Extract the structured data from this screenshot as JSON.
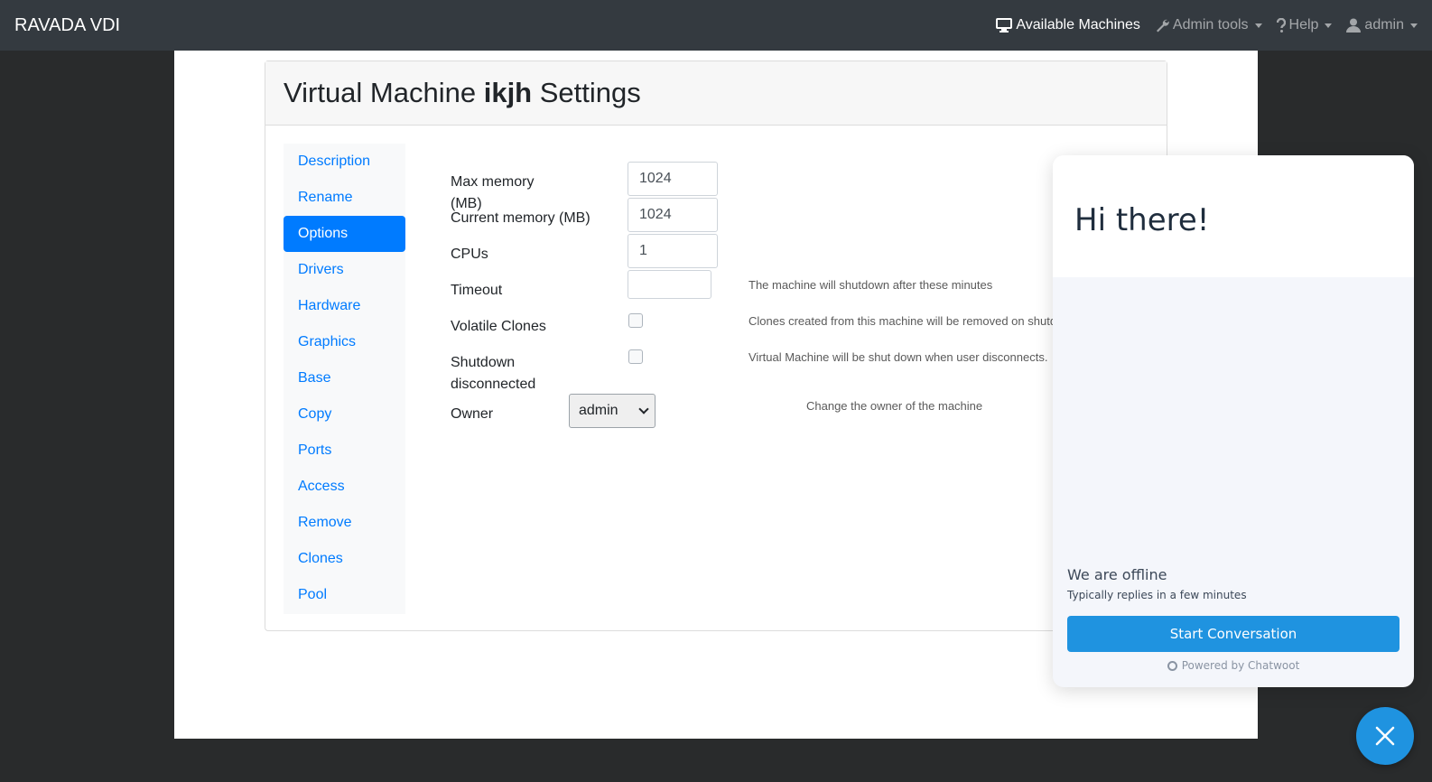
{
  "navbar": {
    "brand": "RAVADA VDI",
    "items": [
      {
        "label": "Available Machines",
        "icon": "desktop-icon"
      },
      {
        "label": "Admin tools",
        "icon": "wrench-icon"
      },
      {
        "label": "Help",
        "icon": "question-icon"
      },
      {
        "label": "admin",
        "icon": "user-icon"
      }
    ]
  },
  "page": {
    "title_prefix": "Virtual Machine ",
    "title_name": "ikjh",
    "title_suffix": " Settings"
  },
  "sidenav": {
    "items": [
      "Description",
      "Rename",
      "Options",
      "Drivers",
      "Hardware",
      "Graphics",
      "Base",
      "Copy",
      "Ports",
      "Access",
      "Remove",
      "Clones",
      "Pool"
    ],
    "active": "Options"
  },
  "options": {
    "max_memory_label": "Max memory (MB)",
    "max_memory_value": "1024",
    "current_memory_label": "Current memory (MB)",
    "current_memory_value": "1024",
    "cpus_label": "CPUs",
    "cpus_value": "1",
    "timeout_label": "Timeout",
    "timeout_value": "",
    "timeout_hint": "The machine will shutdown after these minutes",
    "volatile_label": "Volatile Clones",
    "volatile_hint": "Clones created from this machine will be removed on shutdo",
    "shutdown_label": "Shutdown disconnected",
    "shutdown_hint": "Virtual Machine will be shut down when user disconnects.",
    "owner_label": "Owner",
    "owner_value": "admin",
    "owner_hint": "Change the owner of the machine"
  },
  "chat": {
    "greeting": "Hi there!",
    "status": "We are offline",
    "reply_time": "Typically replies in a few minutes",
    "start_button": "Start Conversation",
    "powered_by": "Powered by Chatwoot",
    "accent": "#1f93e0"
  }
}
